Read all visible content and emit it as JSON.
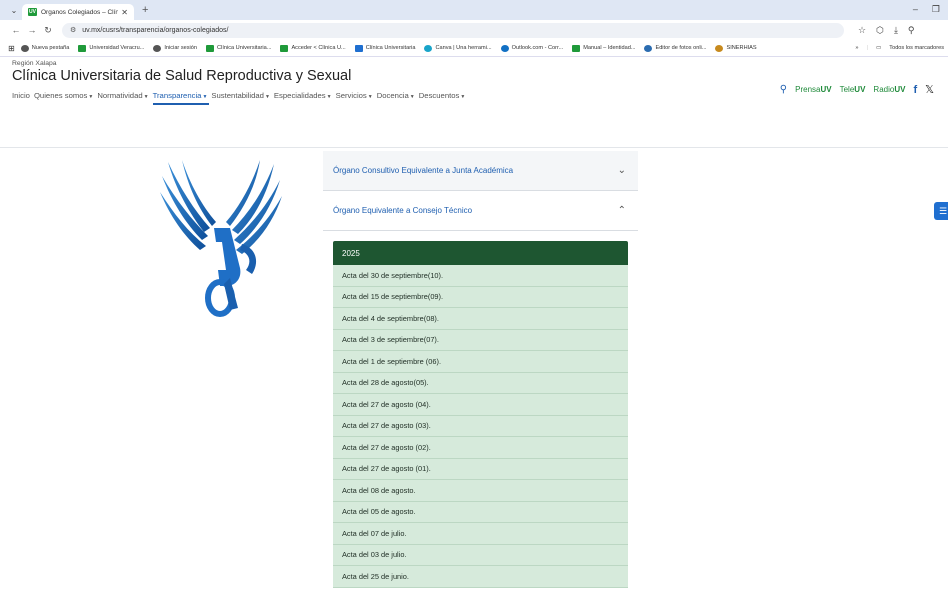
{
  "browser": {
    "tab_title": "Órganos Colegiados – Clínica U",
    "tab_favicon": "UV",
    "url": "uv.mx/cusrs/transparencia/organos-colegiados/",
    "bookmarks": [
      {
        "label": "Nueva pestaña",
        "icon": "globe-icon",
        "color": "#555555"
      },
      {
        "label": "Universidad Veracru...",
        "icon": "uv-icon",
        "color": "#1f9a3a"
      },
      {
        "label": "Iniciar sesión",
        "icon": "globe-icon",
        "color": "#555555"
      },
      {
        "label": "Clínica Universitaria...",
        "icon": "uv-icon",
        "color": "#1f9a3a"
      },
      {
        "label": "Acceder < Clínica U...",
        "icon": "uv-icon",
        "color": "#1f9a3a"
      },
      {
        "label": "Clínica Universitaria",
        "icon": "c-icon",
        "color": "#1f6fd0"
      },
      {
        "label": "Canva | Una herrami...",
        "icon": "canva-icon",
        "color": "#19a4c9"
      },
      {
        "label": "Outlook.com - Corr...",
        "icon": "outlook-icon",
        "color": "#1170c4"
      },
      {
        "label": "Manual – Identidad...",
        "icon": "uv-icon",
        "color": "#1f9a3a"
      },
      {
        "label": "Editor de fotos onli...",
        "icon": "photo-icon",
        "color": "#2b6cb0"
      },
      {
        "label": "SINERHIAS",
        "icon": "circle-icon",
        "color": "#c78a1e"
      }
    ],
    "all_bookmarks_label": "Todos los marcadores"
  },
  "site": {
    "region": "Región Xalapa",
    "title": "Clínica Universitaria de Salud Reproductiva y Sexual",
    "nav": [
      {
        "label": "Inicio",
        "dropdown": false,
        "active": false
      },
      {
        "label": "Quienes somos",
        "dropdown": true,
        "active": false
      },
      {
        "label": "Normatividad",
        "dropdown": true,
        "active": false
      },
      {
        "label": "Transparencia",
        "dropdown": true,
        "active": true
      },
      {
        "label": "Sustentabilidad",
        "dropdown": true,
        "active": false
      },
      {
        "label": "Especialidades",
        "dropdown": true,
        "active": false
      },
      {
        "label": "Servicios",
        "dropdown": true,
        "active": false
      },
      {
        "label": "Docencia",
        "dropdown": true,
        "active": false
      },
      {
        "label": "Descuentos",
        "dropdown": true,
        "active": false
      }
    ],
    "media": {
      "prensa_prefix": "Prensa",
      "prensa_suffix": "UV",
      "tele_prefix": "Tele",
      "tele_suffix": "UV",
      "radio_prefix": "Radio",
      "radio_suffix": "UV",
      "facebook": "f",
      "x": "𝕏"
    },
    "accent_color": "#1f5fb0",
    "green_color": "#1e5631"
  },
  "accordion": {
    "section1_title": "Órgano Consultivo Equivalente a Junta Académica",
    "section2_title": "Órgano Equivalente a Consejo Técnico",
    "year": "2025",
    "actas": [
      "Acta del 30 de septiembre(10).",
      "Acta del 15 de septiembre(09).",
      "Acta del 4 de septiembre(08).",
      "Acta del 3 de septiembre(07).",
      "Acta del 1 de septiembre (06).",
      "Acta del 28 de agosto(05).",
      "Acta del 27 de agosto (04).",
      "Acta del 27 de agosto (03).",
      "Acta del 27 de agosto (02).",
      "Acta del 27 de agosto (01).",
      "Acta del 08 de agosto.",
      "Acta del 05 de agosto.",
      "Acta del 07 de julio.",
      "Acta del 03 de julio.",
      "Acta del 25 de junio."
    ]
  }
}
